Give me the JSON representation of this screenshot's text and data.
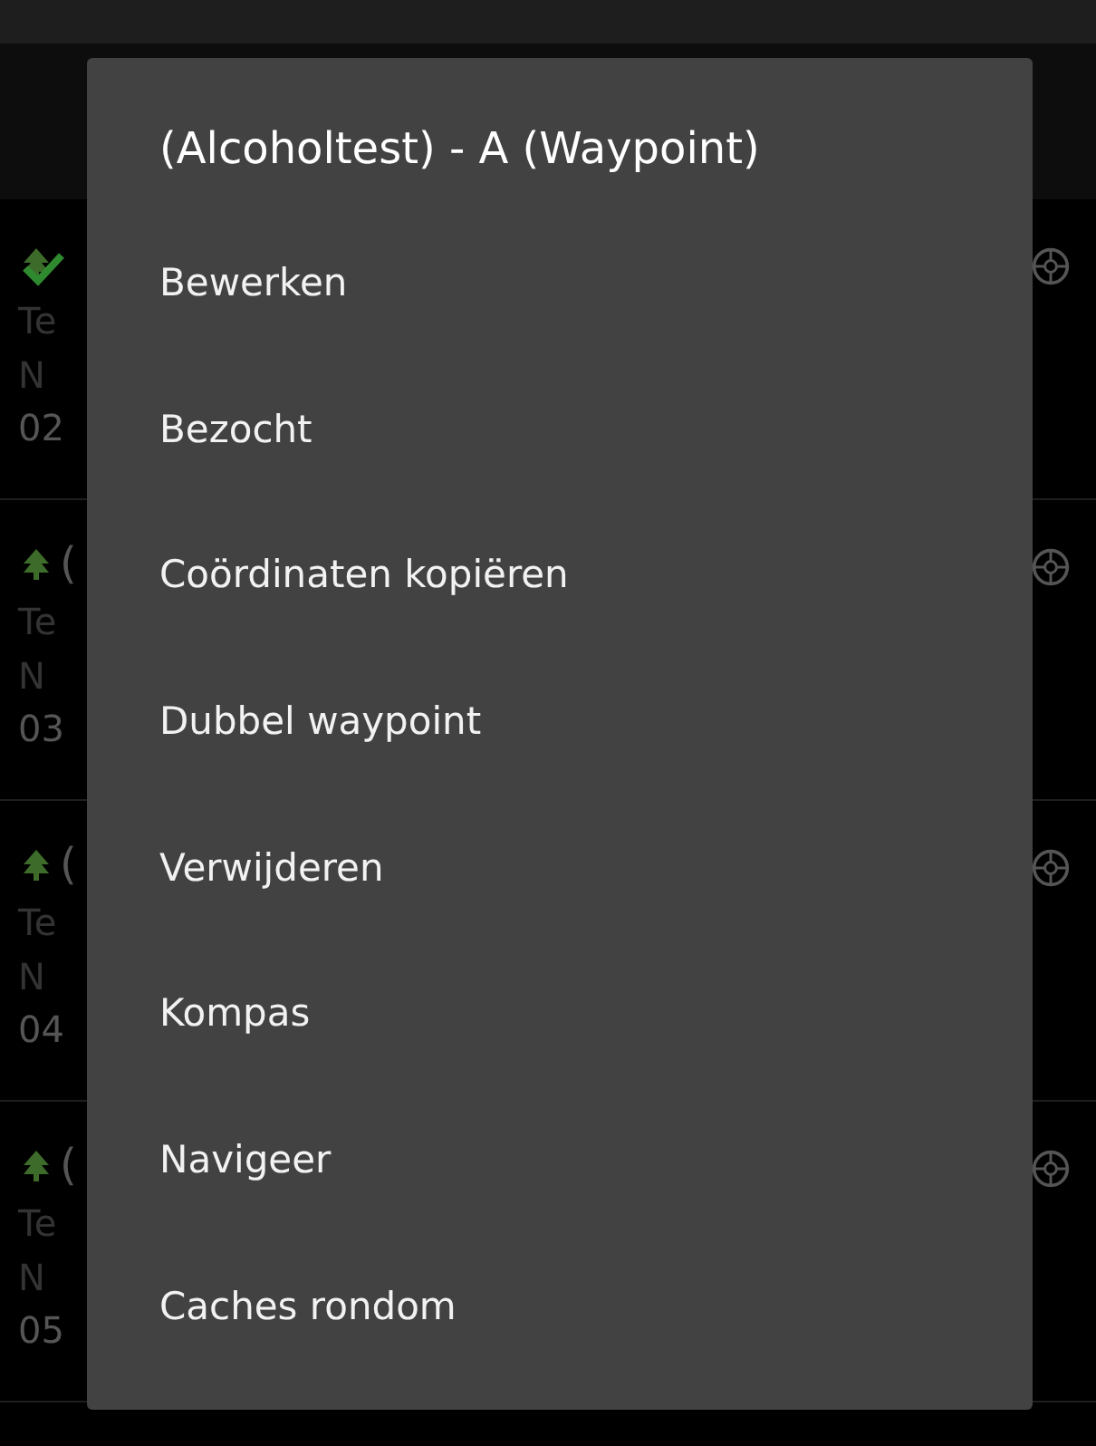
{
  "list": {
    "rows": [
      {
        "found": true,
        "title": "",
        "line_2": "Te",
        "line_3": "N",
        "line_4": "02"
      },
      {
        "found": false,
        "title": "(",
        "line_2": "Te",
        "line_3": "N",
        "line_4": "03"
      },
      {
        "found": false,
        "title": "(",
        "line_2": "Te",
        "line_3": "N",
        "line_4": "04"
      },
      {
        "found": false,
        "title": "(",
        "line_2": "Te",
        "line_3": "N",
        "line_4": "05"
      }
    ]
  },
  "menu": {
    "title": "(Alcoholtest) - A (Waypoint)",
    "items": [
      "Bewerken",
      "Bezocht",
      "Coördinaten kopiëren",
      "Dubbel waypoint",
      "Verwijderen",
      "Kompas",
      "Navigeer",
      "Caches rondom"
    ]
  }
}
